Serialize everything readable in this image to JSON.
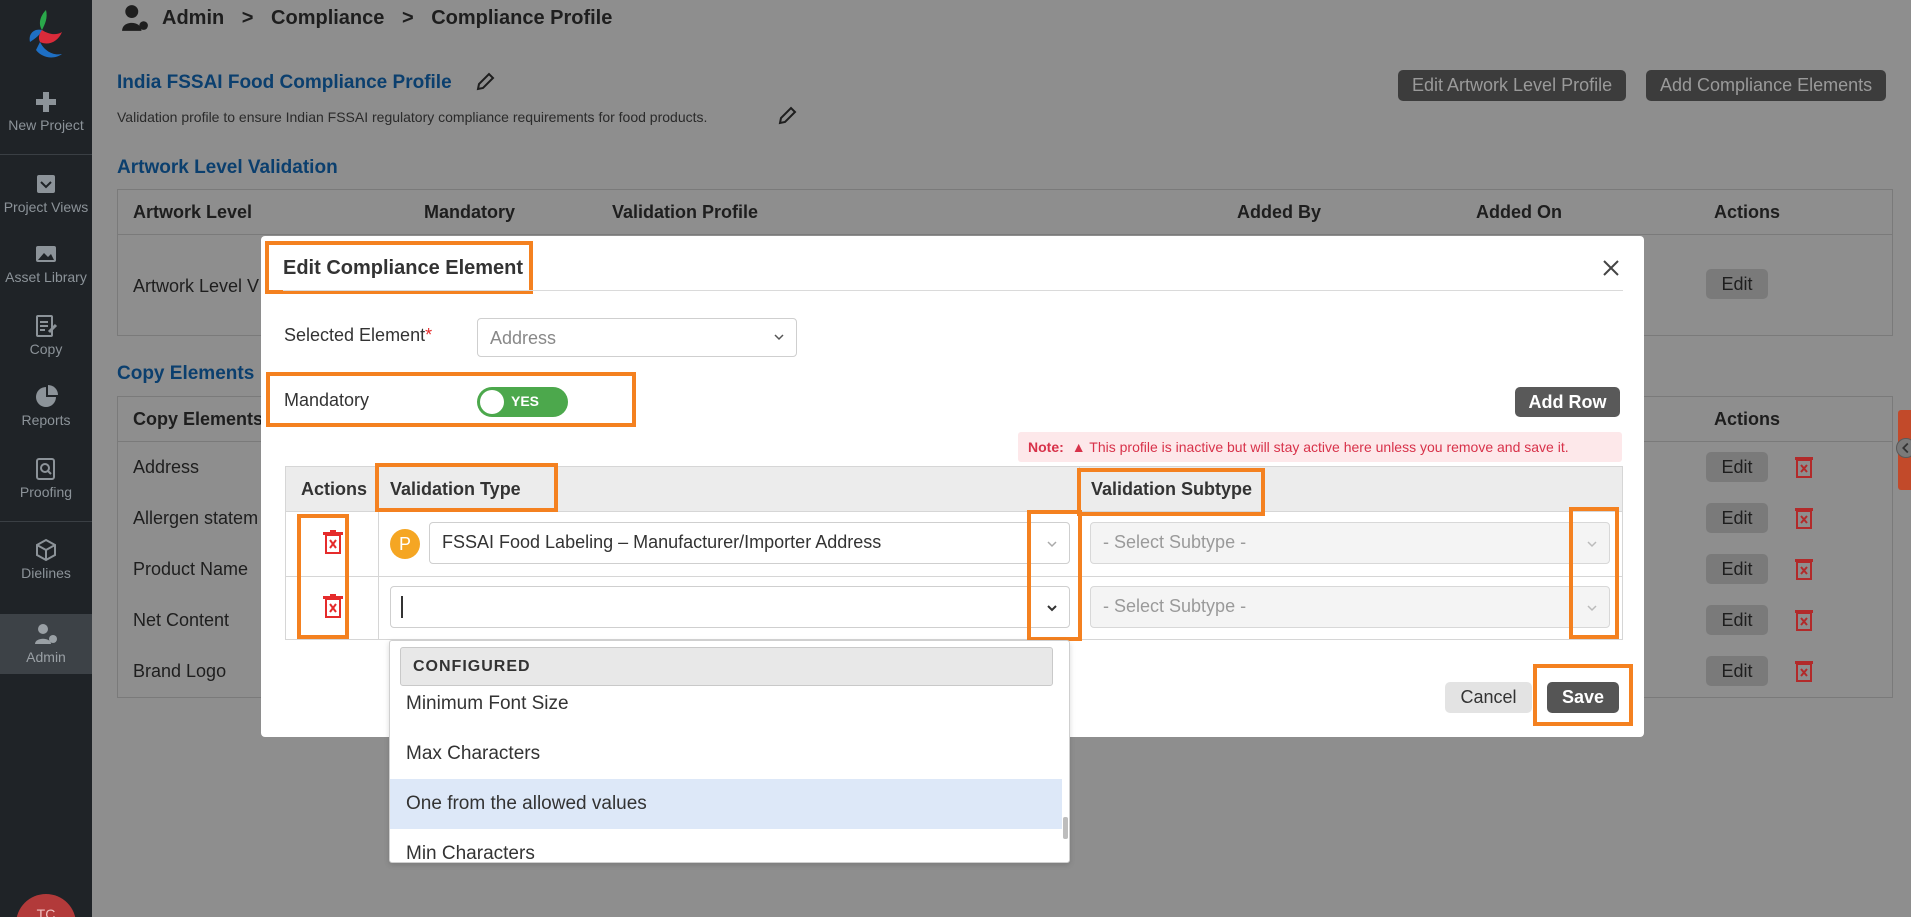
{
  "sidebar": {
    "items": [
      {
        "label": "New Project",
        "icon": "plus-icon"
      },
      {
        "label": "Project Views",
        "icon": "inbox-icon"
      },
      {
        "label": "Asset Library",
        "icon": "image-icon"
      },
      {
        "label": "Copy",
        "icon": "edit-document-icon"
      },
      {
        "label": "Reports",
        "icon": "pie-chart-icon"
      },
      {
        "label": "Proofing",
        "icon": "search-document-icon"
      },
      {
        "label": "Dielines",
        "icon": "box-icon"
      },
      {
        "label": "Admin",
        "icon": "user-gear-icon"
      }
    ],
    "avatar_initials": "TC"
  },
  "breadcrumb": {
    "items": [
      "Admin",
      "Compliance",
      "Compliance Profile"
    ],
    "separator": ">"
  },
  "profile": {
    "title": "India FSSAI Food Compliance Profile",
    "description": "Validation profile to ensure Indian FSSAI regulatory compliance requirements for food products.",
    "edit_artwork_label": "Edit Artwork Level Profile",
    "add_elements_label": "Add Compliance Elements"
  },
  "artwork_section": {
    "title": "Artwork Level Validation",
    "headers": [
      "Artwork Level",
      "Mandatory",
      "Validation Profile",
      "Added By",
      "Added On",
      "Actions"
    ],
    "row_first_cell": "Artwork Level V",
    "edit_label": "Edit"
  },
  "copy_section": {
    "title": "Copy Elements",
    "header": "Copy Elements",
    "actions_header": "Actions",
    "rows": [
      "Address",
      "Allergen statem",
      "Product Name",
      "Net Content",
      "Brand Logo"
    ],
    "edit_label": "Edit"
  },
  "modal": {
    "title": "Edit Compliance Element",
    "selected_element_label": "Selected Element",
    "required_mark": "*",
    "selected_element_value": "Address",
    "mandatory_label": "Mandatory",
    "toggle_text": "YES",
    "add_row_label": "Add Row",
    "note_label": "Note:",
    "note_text": "This profile is inactive but will stay active here unless you remove and save it.",
    "grid_headers": {
      "actions": "Actions",
      "validation_type": "Validation Type",
      "validation_subtype": "Validation Subtype"
    },
    "rows": [
      {
        "badge": "P",
        "validation_type": "FSSAI Food Labeling – Manufacturer/Importer Address",
        "subtype_placeholder": "- Select Subtype -"
      },
      {
        "badge": "",
        "validation_type": "",
        "subtype_placeholder": "- Select Subtype -"
      }
    ],
    "cancel_label": "Cancel",
    "save_label": "Save"
  },
  "dropdown": {
    "group_label": "CONFIGURED",
    "options": [
      "Minimum Font Size",
      "Max Characters",
      "One from the allowed values",
      "Min Characters"
    ],
    "hovered_index": 2
  },
  "colors": {
    "highlight": "#f48120",
    "sidebar_bg": "#1f2327",
    "toggle_on": "#4ca84c",
    "link_blue": "#0b3f6e",
    "delete_red": "#e52b2b",
    "note_red": "#d8324a"
  }
}
